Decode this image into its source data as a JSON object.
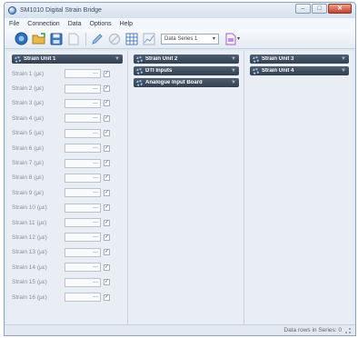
{
  "window": {
    "title": "SM1010 Digital Strain Bridge",
    "minimize_glyph": "–",
    "maximize_glyph": "□",
    "close_glyph": "✕"
  },
  "menu": [
    {
      "label": "File"
    },
    {
      "label": "Connection"
    },
    {
      "label": "Data"
    },
    {
      "label": "Options"
    },
    {
      "label": "Help"
    }
  ],
  "toolbar": {
    "buttons": [
      {
        "name": "connect-icon"
      },
      {
        "name": "open-folder-icon"
      },
      {
        "name": "save-icon"
      },
      {
        "name": "document-icon"
      },
      {
        "name": "pencil-icon"
      },
      {
        "name": "no-entry-icon"
      },
      {
        "name": "table-icon"
      },
      {
        "name": "chart-icon"
      }
    ],
    "series_select": {
      "value": "Data Series 1"
    },
    "export_menu": {
      "icon": "export-document-icon"
    }
  },
  "columns": {
    "col1": {
      "groups": [
        {
          "label": "Strain Unit 1",
          "collapse_glyph": "▼",
          "rows": [
            {
              "label": "Strain 1  (µε)",
              "value": "---",
              "check": "✓"
            },
            {
              "label": "Strain 2  (µε)",
              "value": "---",
              "check": "✓"
            },
            {
              "label": "Strain 3  (µε)",
              "value": "---",
              "check": "✓"
            },
            {
              "label": "Strain 4  (µε)",
              "value": "---",
              "check": "✓"
            },
            {
              "label": "Strain 5  (µε)",
              "value": "---",
              "check": "✓"
            },
            {
              "label": "Strain 6  (µε)",
              "value": "---",
              "check": "✓"
            },
            {
              "label": "Strain 7  (µε)",
              "value": "---",
              "check": "✓"
            },
            {
              "label": "Strain 8  (µε)",
              "value": "---",
              "check": "✓"
            },
            {
              "label": "Strain 9  (µε)",
              "value": "---",
              "check": "✓"
            },
            {
              "label": "Strain 10  (µε)",
              "value": "---",
              "check": "✓"
            },
            {
              "label": "Strain 11  (µε)",
              "value": "---",
              "check": "✓"
            },
            {
              "label": "Strain 12  (µε)",
              "value": "---",
              "check": "✓"
            },
            {
              "label": "Strain 13  (µε)",
              "value": "---",
              "check": "✓"
            },
            {
              "label": "Strain 14  (µε)",
              "value": "---",
              "check": "✓"
            },
            {
              "label": "Strain 15  (µε)",
              "value": "---",
              "check": "✓"
            },
            {
              "label": "Strain 16  (µε)",
              "value": "---",
              "check": "✓"
            }
          ]
        }
      ]
    },
    "col2": {
      "groups": [
        {
          "label": "Strain Unit 2",
          "collapse_glyph": "▼"
        },
        {
          "label": "DTI Inputs",
          "collapse_glyph": "▼"
        },
        {
          "label": "Analogue Input Board",
          "collapse_glyph": "▼"
        }
      ]
    },
    "col3": {
      "groups": [
        {
          "label": "Strain Unit 3",
          "collapse_glyph": "▼"
        },
        {
          "label": "Strain Unit 4",
          "collapse_glyph": "▼"
        }
      ]
    }
  },
  "status": {
    "text": "Data rows in Series: 0"
  },
  "colors": {
    "group_header": "#3f4c5e",
    "window_frame": "#dfe8f3",
    "close_button": "#c4402b"
  }
}
